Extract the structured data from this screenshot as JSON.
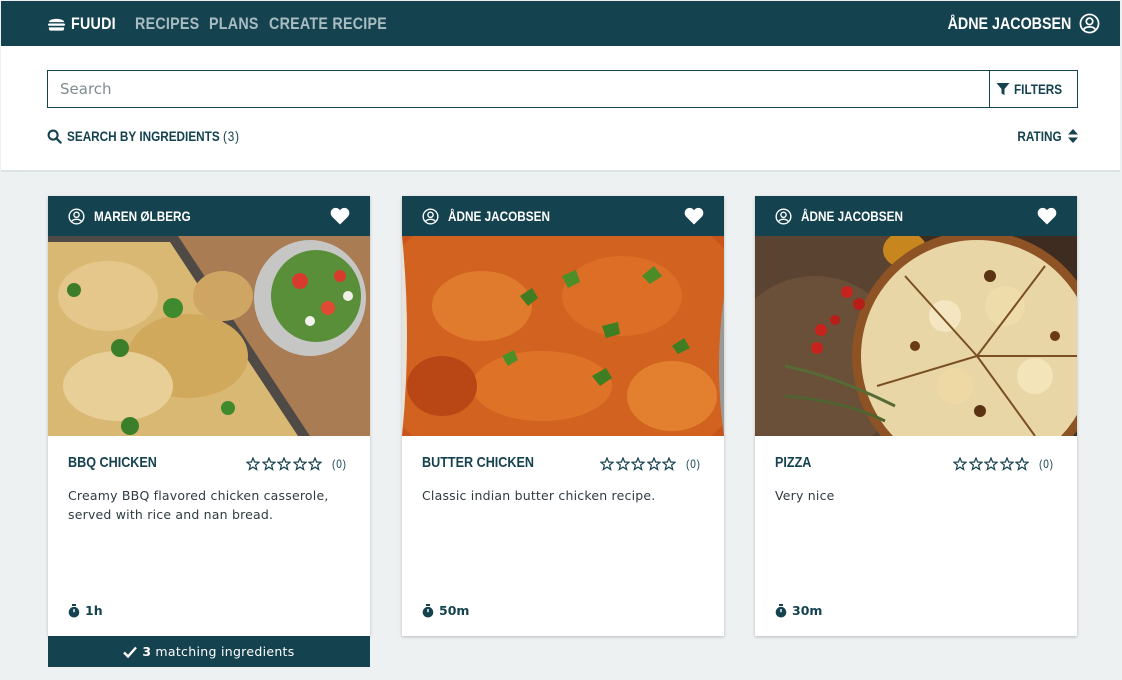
{
  "header": {
    "brand": "FUUDI",
    "nav": [
      {
        "label": "RECIPES"
      },
      {
        "label": "PLANS"
      },
      {
        "label": "CREATE RECIPE"
      }
    ],
    "user_name": "ÅDNE JACOBSEN"
  },
  "search": {
    "placeholder": "Search",
    "value": "",
    "filters_label": "FILTERS",
    "by_ingredients_label": "SEARCH BY INGREDIENTS",
    "by_ingredients_count": "(3)",
    "sort_label": "RATING"
  },
  "recipes": [
    {
      "author": "MAREN ØLBERG",
      "title": "BBQ CHICKEN",
      "rating": 0,
      "rating_count": "(0)",
      "description": "Creamy BBQ flavored chicken casserole, served with rice and nan bread.",
      "time": "1h",
      "match_count": "3",
      "match_label": "matching ingredients"
    },
    {
      "author": "ÅDNE JACOBSEN",
      "title": "BUTTER CHICKEN",
      "rating": 0,
      "rating_count": "(0)",
      "description": "Classic indian butter chicken recipe.",
      "time": "50m"
    },
    {
      "author": "ÅDNE JACOBSEN",
      "title": "PIZZA",
      "rating": 0,
      "rating_count": "(0)",
      "description": "Very nice",
      "time": "30m"
    }
  ],
  "colors": {
    "primary": "#15424f",
    "background": "#edf1f1",
    "nav_inactive": "#a9bcc2"
  },
  "icons": [
    "burger-icon",
    "user-circle-icon",
    "filter-icon",
    "search-icon",
    "sort-icon",
    "heart-icon",
    "star-outline-icon",
    "stopwatch-icon",
    "check-icon"
  ]
}
